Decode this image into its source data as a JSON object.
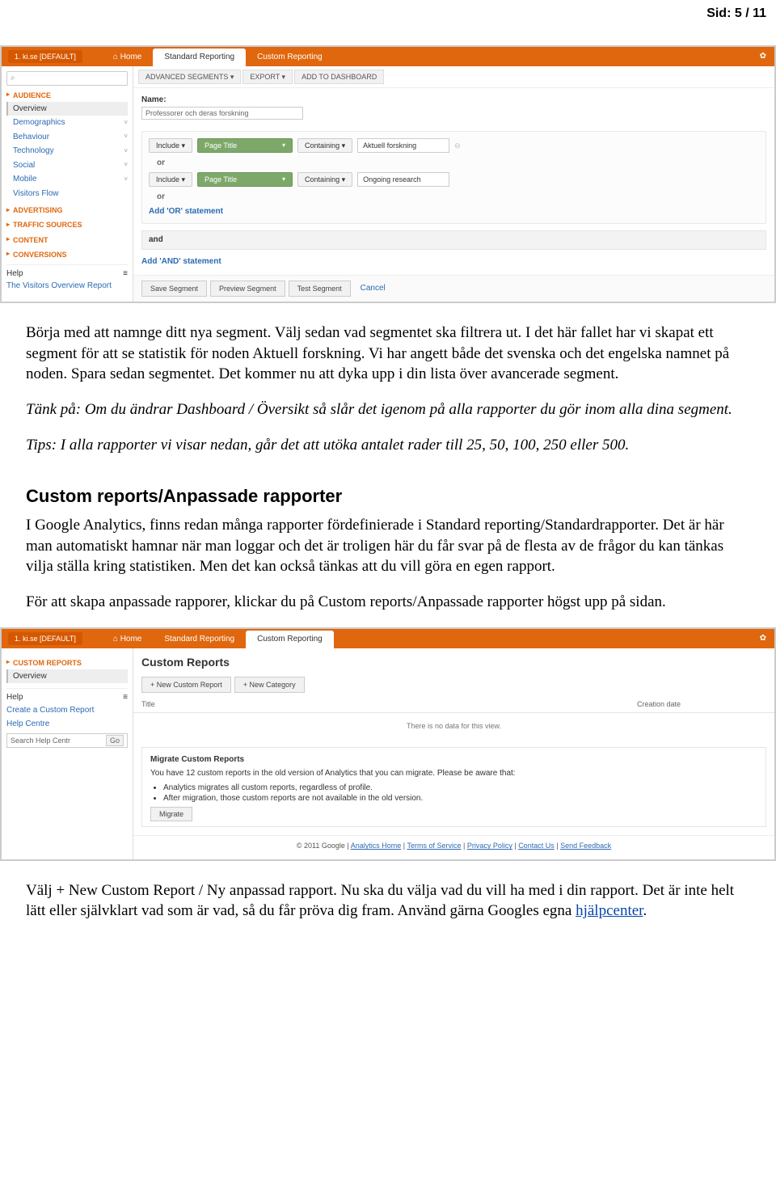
{
  "page_number": "Sid: 5 / 11",
  "body": {
    "p1": "Börja med att namnge ditt nya segment. Välj sedan vad segmentet ska filtrera ut. I det här fallet har vi skapat ett segment för att se statistik för noden Aktuell forskning. Vi har angett både det svenska och det engelska namnet på noden. Spara sedan segmentet. Det kommer nu att dyka upp i din lista över avancerade segment.",
    "p2": "Tänk på: Om du ändrar Dashboard / Översikt så slår det igenom på alla rapporter du gör inom alla dina segment.",
    "p3": "Tips: I alla rapporter vi visar nedan, går det att utöka antalet rader till 25, 50, 100, 250 eller 500.",
    "h2": "Custom reports/Anpassade rapporter",
    "p4": "I Google Analytics, finns redan många rapporter fördefinierade i Standard reporting/Standardrapporter. Det är här man automatiskt hamnar när man loggar och det är troligen här du får svar på de flesta av de frågor du kan tänkas vilja ställa kring statistiken. Men det kan också tänkas att du vill göra en egen rapport.",
    "p5": "För att skapa anpassade rapporer, klickar du på Custom reports/Anpassade rapporter högst upp på sidan.",
    "p6a": "Välj + New Custom Report / Ny anpassad rapport. Nu ska du välja vad du vill ha med i din rapport. Det är inte helt lätt eller självklart vad som är vad, så du får pröva dig fram. Använd gärna Googles egna ",
    "p6link": "hjälpcenter",
    "p6b": "."
  },
  "shot_common": {
    "app": "1. ki.se [DEFAULT]",
    "home": "Home",
    "std": "Standard Reporting",
    "cust": "Custom Reporting",
    "gear": "✿"
  },
  "shot1": {
    "sidebar": {
      "search_placeholder": "",
      "audience": "AUDIENCE",
      "overview": "Overview",
      "items": [
        "Demographics",
        "Behaviour",
        "Technology",
        "Social",
        "Mobile"
      ],
      "visitors_flow": "Visitors Flow",
      "sections": [
        "ADVERTISING",
        "TRAFFIC SOURCES",
        "CONTENT",
        "CONVERSIONS"
      ],
      "help": "Help",
      "help_link": "The Visitors Overview Report"
    },
    "toolbar": {
      "adv": "ADVANCED SEGMENTS ▾",
      "export": "EXPORT ▾",
      "add": "ADD TO DASHBOARD"
    },
    "name_label": "Name:",
    "name_value": "Professorer och deras forskning",
    "include": "Include ▾",
    "page_title": "Page Title",
    "containing": "Containing ▾",
    "val1": "Aktuell forskning",
    "val2": "Ongoing research",
    "or": "or",
    "add_or": "Add 'OR' statement",
    "and": "and",
    "add_and": "Add 'AND' statement",
    "save": "Save Segment",
    "preview": "Preview Segment",
    "test": "Test Segment",
    "cancel": "Cancel"
  },
  "shot2": {
    "sidebar": {
      "custom_reports": "CUSTOM REPORTS",
      "overview": "Overview",
      "help": "Help",
      "create": "Create a Custom Report",
      "help_centre": "Help Centre",
      "search_placeholder": "Search Help Centr",
      "go": "Go"
    },
    "title": "Custom Reports",
    "new_report": "+ New Custom Report",
    "new_cat": "+ New Category",
    "col_title": "Title",
    "col_date": "Creation date",
    "empty": "There is no data for this view.",
    "mig_title": "Migrate Custom Reports",
    "mig_text": "You have 12 custom reports in the old version of Analytics that you can migrate. Please be aware that:",
    "mig_b1": "Analytics migrates all custom reports, regardless of profile.",
    "mig_b2": "After migration, those custom reports are not available in the old version.",
    "mig_btn": "Migrate",
    "footer_copy": "© 2011 Google",
    "footer_links": [
      "Analytics Home",
      "Terms of Service",
      "Privacy Policy",
      "Contact Us",
      "Send Feedback"
    ]
  }
}
